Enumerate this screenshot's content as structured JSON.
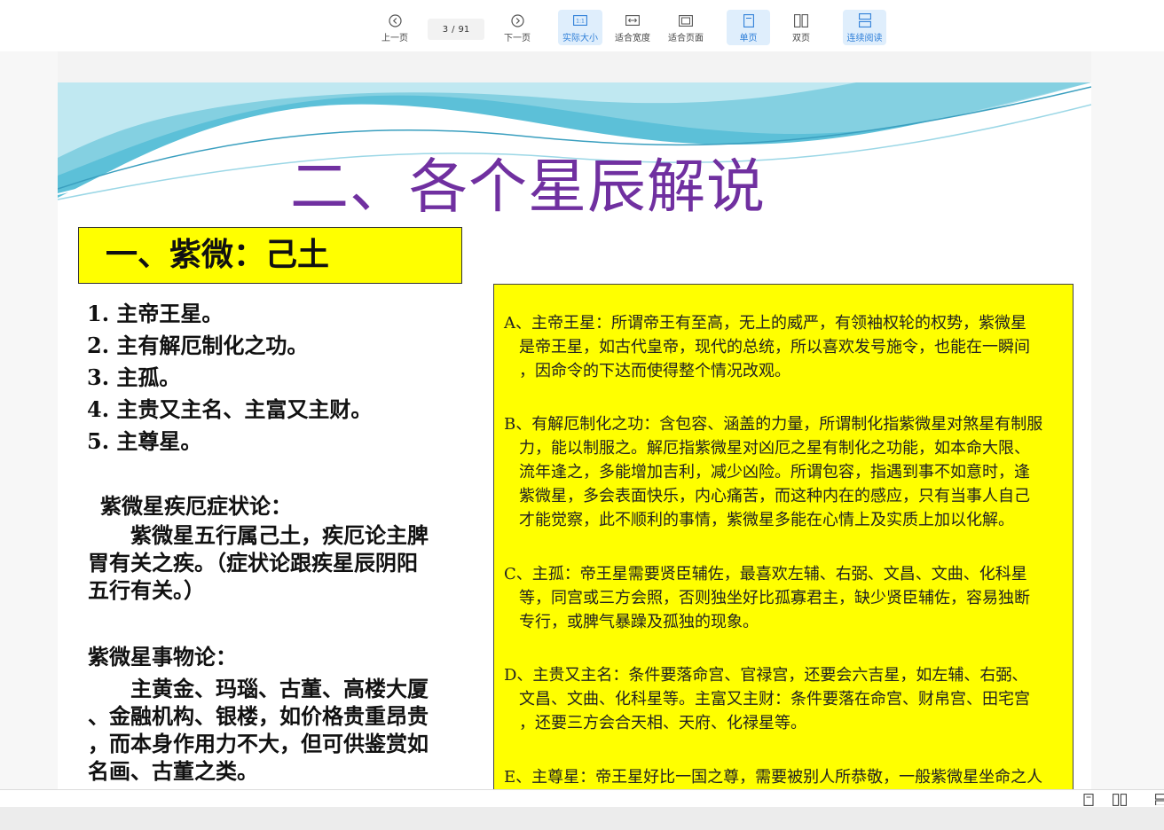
{
  "toolbar": {
    "prev_label": "上一页",
    "page_current": "3",
    "page_sep": "/",
    "page_total": "91",
    "next_label": "下一页",
    "actual_size_label": "实际大小",
    "fit_width_label": "适合宽度",
    "fit_page_label": "适合页面",
    "single_label": "单页",
    "double_label": "双页",
    "continuous_label": "连续阅读"
  },
  "slide": {
    "title": "二、各个星辰解说",
    "heading": "一、紫微：己土",
    "points": [
      "1. 主帝王星。",
      "2. 主有解厄制化之功。",
      "3. 主孤。",
      "4. 主贵又主名、主富又主财。",
      "5. 主尊星。"
    ],
    "illness": {
      "title": "紫微星疾厄症状论：",
      "lines": [
        "　　紫微星五行属己土，疾厄论主脾",
        "胃有关之疾。（症状论跟疾星辰阴阳",
        "五行有关。）"
      ]
    },
    "things": {
      "title": "紫微星事物论：",
      "lines": [
        "　　主黄金、玛瑙、古董、高楼大厦",
        "、金融机构、银楼，如价格贵重昂贵",
        "，而本身作用力不大，但可供鉴赏如",
        "名画、古董之类。"
      ]
    },
    "notes": [
      [
        "A、主帝王星：所谓帝王有至高，无上的威严，有领袖权轮的权势，紫微星",
        "是帝王星，如古代皇帝，现代的总统，所以喜欢发号施令，也能在一瞬间",
        "，因命令的下达而使得整个情况改观。"
      ],
      [
        "B、有解厄制化之功：含包容、涵盖的力量，所谓制化指紫微星对煞星有制服",
        "力，能以制服之。解厄指紫微星对凶厄之星有制化之功能，如本命大限、",
        "流年逢之，多能增加吉利，减少凶险。所谓包容，指遇到事不如意时，逢",
        "紫微星，多会表面快乐，内心痛苦，而这种内在的感应，只有当事人自己",
        "才能觉察，此不顺利的事情，紫微星多能在心情上及实质上加以化解。"
      ],
      [
        "C、主孤：帝王星需要贤臣辅佐，最喜欢左辅、右弼、文昌、文曲、化科星",
        "等，同宫或三方会照，否则独坐好比孤寡君主，缺少贤臣辅佐，容易独断",
        "专行，或脾气暴躁及孤独的现象。"
      ],
      [
        "D、主贵又主名：条件要落命宫、官禄宫，还要会六吉星，如左辅、右弼、",
        "文昌、文曲、化科星等。主富又主财：条件要落在命宫、财帛宫、田宅宫",
        "，还要三方会合天相、天府、化禄星等。"
      ],
      [
        "E、主尊星：帝王星好比一国之尊，需要被别人所恭敬，一般紫微星坐命之人"
      ]
    ]
  },
  "colors": {
    "title": "#7030a0",
    "highlight": "#ffff00",
    "active_button_bg": "#dfeefc",
    "active_button_text": "#2f7fd8"
  },
  "icons": [
    "chevron-left-icon",
    "chevron-right-icon",
    "actual-size-icon",
    "fit-width-icon",
    "fit-page-icon",
    "single-page-icon",
    "double-page-icon",
    "continuous-icon"
  ]
}
